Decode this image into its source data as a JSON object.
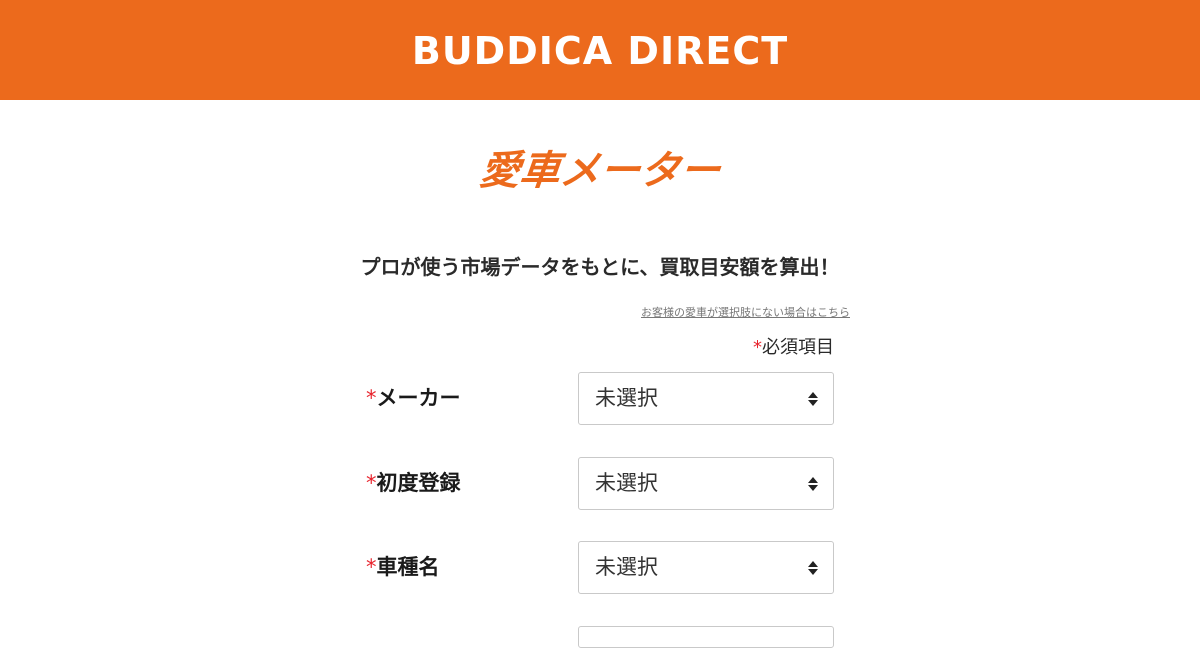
{
  "header": {
    "logo_text": "BUDDICA DIRECT",
    "background_color": "#ec6a1c"
  },
  "brand": {
    "logo_text": "愛車メーター",
    "color": "#ec6a1c"
  },
  "tagline": "プロが使う市場データをもとに、買取目安額を算出！",
  "help_link": "お客様の愛車が選択肢にない場合はこちら",
  "required_note": {
    "star": "*",
    "label": "必須項目",
    "star_color": "#e8242d"
  },
  "form": {
    "fields": [
      {
        "star": "*",
        "label": "メーカー",
        "value": "未選択",
        "icon": "sort-arrows-icon"
      },
      {
        "star": "*",
        "label": "初度登録",
        "value": "未選択",
        "icon": "sort-arrows-icon"
      },
      {
        "star": "*",
        "label": "車種名",
        "value": "未選択",
        "icon": "sort-arrows-icon"
      }
    ]
  }
}
